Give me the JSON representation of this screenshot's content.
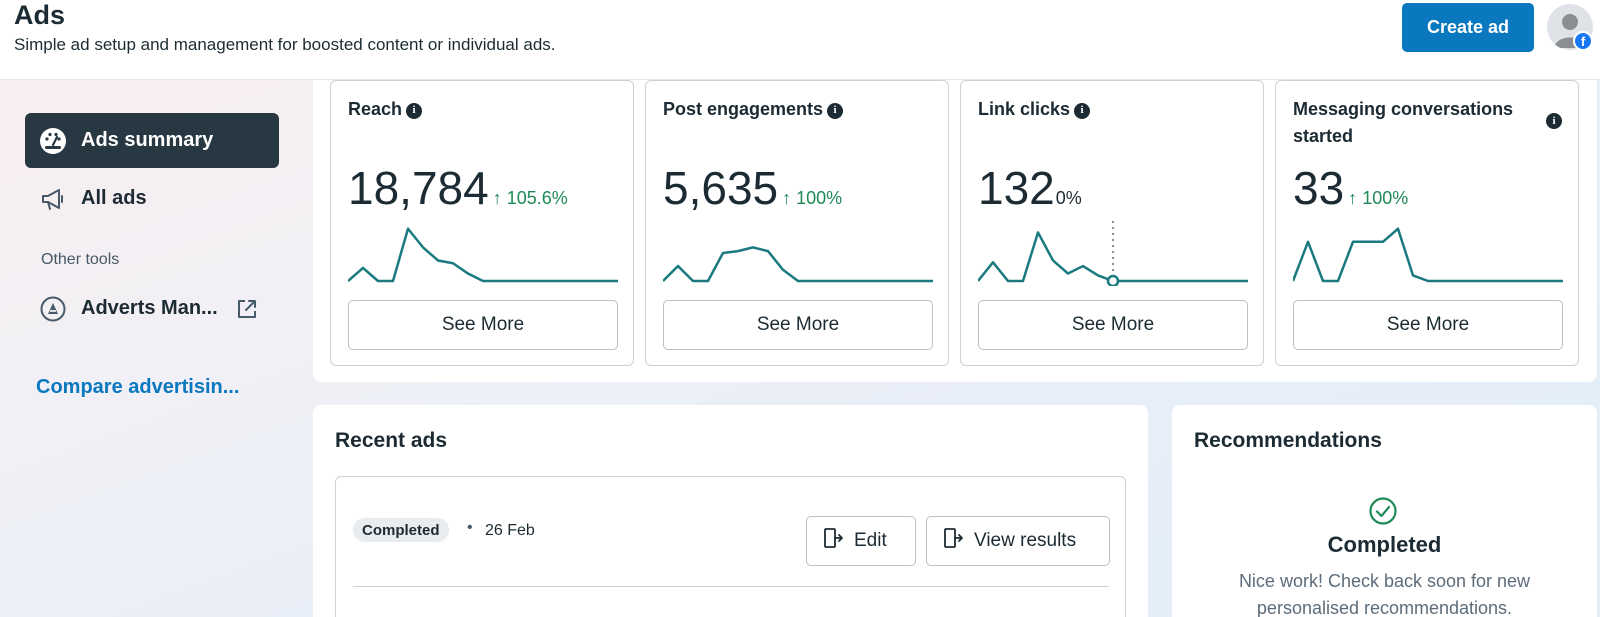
{
  "header": {
    "title": "Ads",
    "subtitle": "Simple ad setup and management for boosted content or individual ads.",
    "create_button": "Create ad"
  },
  "sidebar": {
    "items": [
      {
        "label": "Ads summary",
        "icon": "dashboard-gauge-icon"
      },
      {
        "label": "All ads",
        "icon": "megaphone-icon"
      }
    ],
    "section_label": "Other tools",
    "tools": [
      {
        "label": "Adverts Man...",
        "icon": "ads-manager-icon"
      }
    ],
    "compare_link": "Compare advertisin..."
  },
  "metrics": [
    {
      "title": "Reach",
      "value": "18,784",
      "change": "105.6%",
      "trend": "up",
      "button": "See More",
      "sparkline": [
        0,
        14,
        0,
        0,
        56,
        36,
        22,
        19,
        8,
        0,
        0,
        0,
        0,
        0,
        0,
        0,
        0,
        0,
        0
      ]
    },
    {
      "title": "Post engagements",
      "value": "5,635",
      "change": "100%",
      "trend": "up",
      "button": "See More",
      "sparkline": [
        0,
        16,
        0,
        0,
        30,
        32,
        36,
        32,
        12,
        0,
        0,
        0,
        0,
        0,
        0,
        0,
        0,
        0,
        0
      ]
    },
    {
      "title": "Link clicks",
      "value": "132",
      "change": "0%",
      "trend": "none",
      "button": "See More",
      "sparkline": [
        0,
        20,
        0,
        0,
        52,
        22,
        8,
        16,
        6,
        0,
        0,
        0,
        0,
        0,
        0,
        0,
        0,
        0,
        0
      ]
    },
    {
      "title": "Messaging conversations started",
      "value": "33",
      "change": "100%",
      "trend": "up",
      "button": "See More",
      "sparkline": [
        0,
        42,
        0,
        0,
        42,
        42,
        42,
        56,
        6,
        0,
        0,
        0,
        0,
        0,
        0,
        0,
        0,
        0,
        0
      ]
    }
  ],
  "recent_ads": {
    "title": "Recent ads",
    "status": "Completed",
    "date": "26 Feb",
    "edit_button": "Edit",
    "view_results_button": "View results"
  },
  "recommendations": {
    "title": "Recommendations",
    "status": "Completed",
    "message": "Nice work! Check back soon for new personalised recommendations."
  },
  "colors": {
    "accent": "#0a78be",
    "sparkline": "#1a7a7f",
    "positive": "#1f8a57",
    "active_nav": "#283842"
  }
}
